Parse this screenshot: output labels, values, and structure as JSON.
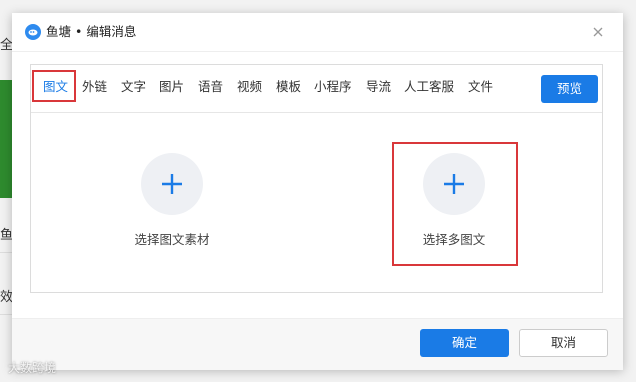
{
  "dialog": {
    "title": "鱼塘 • 编辑消息",
    "close_icon": "close-icon"
  },
  "background": {
    "chars": [
      "全",
      "鱼",
      "效"
    ]
  },
  "tabs": [
    {
      "label": "图文",
      "active": true
    },
    {
      "label": "外链",
      "active": false
    },
    {
      "label": "文字",
      "active": false
    },
    {
      "label": "图片",
      "active": false
    },
    {
      "label": "语音",
      "active": false
    },
    {
      "label": "视频",
      "active": false
    },
    {
      "label": "模板",
      "active": false
    },
    {
      "label": "小程序",
      "active": false
    },
    {
      "label": "导流",
      "active": false
    },
    {
      "label": "人工客服",
      "active": false
    },
    {
      "label": "文件",
      "active": false
    }
  ],
  "preview_label": "预览",
  "options": [
    {
      "label": "选择图文素材",
      "icon": "plus-icon"
    },
    {
      "label": "选择多图文",
      "icon": "plus-icon"
    }
  ],
  "footer": {
    "confirm_label": "确定",
    "cancel_label": "取消"
  },
  "watermark": "大数跨境",
  "colors": {
    "accent": "#1a7be6",
    "highlight": "#d9373a"
  }
}
